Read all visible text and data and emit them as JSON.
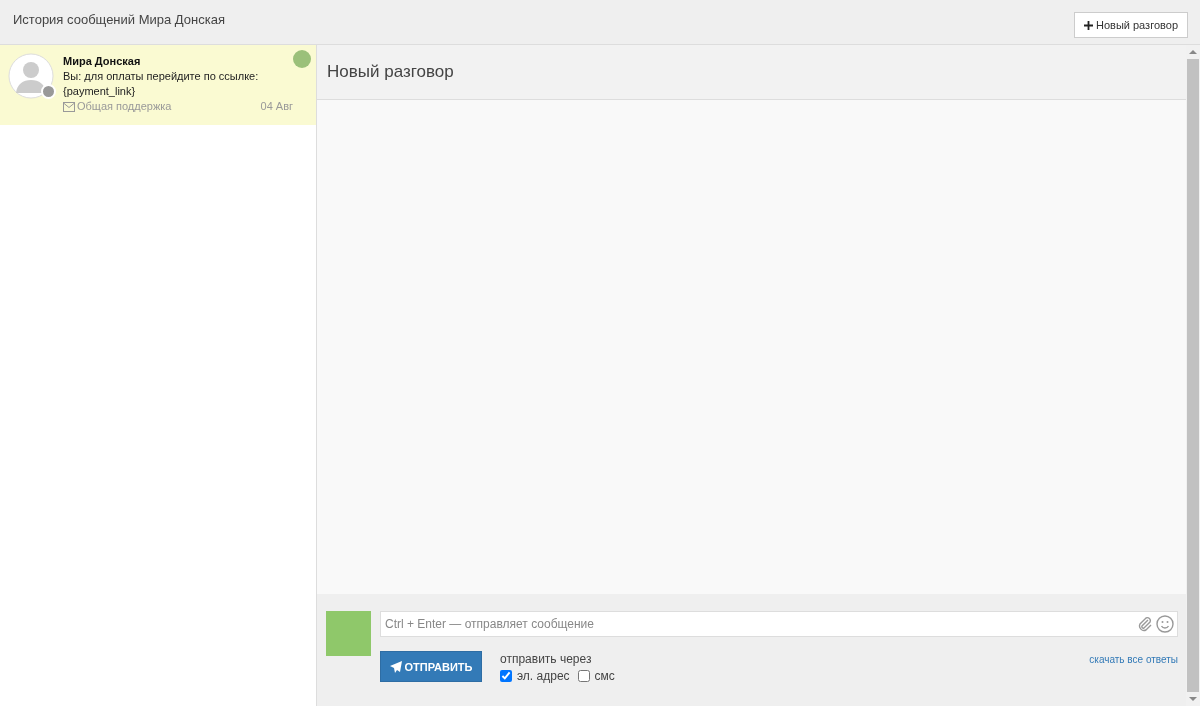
{
  "header": {
    "title": "История сообщений Мира Донская",
    "new_button": "Новый разговор"
  },
  "conversations": [
    {
      "name": "Мира Донская",
      "preview": "Вы: для оплаты перейдите по ссылке: {payment_link}",
      "channel": "Общая поддержка",
      "date": "04 Авг",
      "selected": true,
      "online": false
    }
  ],
  "chat": {
    "title": "Новый разговор"
  },
  "composer": {
    "placeholder": "Ctrl + Enter — отправляет сообщение",
    "send_button": "ОТПРАВИТЬ",
    "via_label": "отправить через",
    "options": [
      {
        "label": "эл. адрес",
        "checked": true
      },
      {
        "label": "смс",
        "checked": false
      }
    ],
    "download_link": "скачать все ответы"
  }
}
